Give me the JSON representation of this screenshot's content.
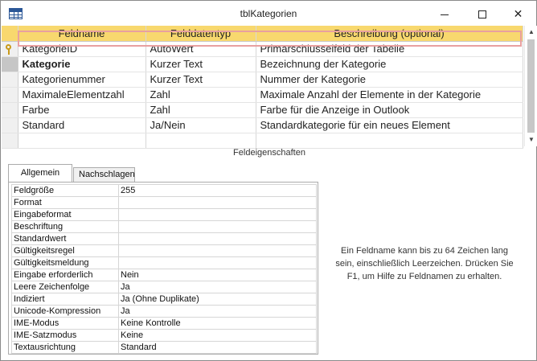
{
  "window": {
    "title": "tblKategorien",
    "icon": "table-icon",
    "controls": [
      "minimize-icon",
      "maximize-icon",
      "close-icon"
    ],
    "close_glyph": "✕"
  },
  "grid": {
    "columns": [
      "Feldname",
      "Felddatentyp",
      "Beschreibung (optional)"
    ],
    "header_color": "#f8d86e",
    "rows": [
      {
        "name": "KategorieID",
        "type": "AutoWert",
        "desc": "Primärschlüsselfeld der Tabelle",
        "primary_key": true
      },
      {
        "name": "Kategorie",
        "type": "Kurzer Text",
        "desc": "Bezeichnung der Kategorie",
        "active": true
      },
      {
        "name": "Kategorienummer",
        "type": "Kurzer Text",
        "desc": "Nummer der Kategorie"
      },
      {
        "name": "MaximaleElementzahl",
        "type": "Zahl",
        "desc": "Maximale Anzahl der Elemente in der Kategorie"
      },
      {
        "name": "Farbe",
        "type": "Zahl",
        "desc": "Farbe für die Anzeige in Outlook"
      },
      {
        "name": "Standard",
        "type": "Ja/Nein",
        "desc": "Standardkategorie für ein neues Element"
      }
    ]
  },
  "scrollbar": {
    "up": "▲",
    "down": "▼"
  },
  "properties": {
    "section_title": "Feldeigenschaften",
    "tabs": [
      "Allgemein",
      "Nachschlagen"
    ],
    "active_tab": "Allgemein",
    "rows": [
      {
        "label": "Feldgröße",
        "value": "255"
      },
      {
        "label": "Format",
        "value": ""
      },
      {
        "label": "Eingabeformat",
        "value": ""
      },
      {
        "label": "Beschriftung",
        "value": ""
      },
      {
        "label": "Standardwert",
        "value": ""
      },
      {
        "label": "Gültigkeitsregel",
        "value": ""
      },
      {
        "label": "Gültigkeitsmeldung",
        "value": ""
      },
      {
        "label": "Eingabe erforderlich",
        "value": "Nein"
      },
      {
        "label": "Leere Zeichenfolge",
        "value": "Ja"
      },
      {
        "label": "Indiziert",
        "value": "Ja (Ohne Duplikate)"
      },
      {
        "label": "Unicode-Kompression",
        "value": "Ja"
      },
      {
        "label": "IME-Modus",
        "value": "Keine Kontrolle"
      },
      {
        "label": "IME-Satzmodus",
        "value": "Keine"
      },
      {
        "label": "Textausrichtung",
        "value": "Standard"
      }
    ],
    "help_text": "Ein Feldname kann bis zu 64 Zeichen lang sein, einschließlich Leerzeichen. Drücken Sie F1, um Hilfe zu Feldnamen zu erhalten."
  }
}
